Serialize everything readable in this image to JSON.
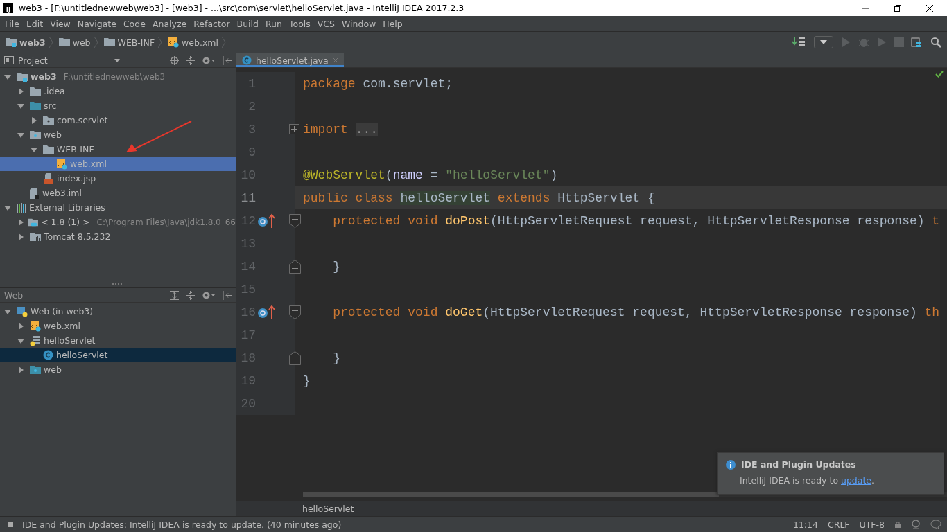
{
  "title_bar": {
    "logo": "IJ",
    "title": "web3 - [F:\\untitlednewweb\\web3] - [web3] - ...\\src\\com\\servlet\\helloServlet.java - IntelliJ IDEA 2017.2.3"
  },
  "menu": [
    {
      "label": "File"
    },
    {
      "label": "Edit"
    },
    {
      "label": "View"
    },
    {
      "label": "Navigate"
    },
    {
      "label": "Code"
    },
    {
      "label": "Analyze"
    },
    {
      "label": "Refactor"
    },
    {
      "label": "Build"
    },
    {
      "label": "Run"
    },
    {
      "label": "Tools"
    },
    {
      "label": "VCS"
    },
    {
      "label": "Window"
    },
    {
      "label": "Help"
    }
  ],
  "breadcrumbs": [
    {
      "label": "web3",
      "kind": "project"
    },
    {
      "label": "web",
      "kind": "folder"
    },
    {
      "label": "WEB-INF",
      "kind": "folder"
    },
    {
      "label": "web.xml",
      "kind": "xml"
    }
  ],
  "project_panel": {
    "title": "Project",
    "active": true,
    "tree": [
      {
        "label": "web3",
        "hint": "F:\\untitlednewweb\\web3",
        "kind": "project",
        "expanded": true,
        "selected": false,
        "children": [
          {
            "label": ".idea",
            "kind": "folder",
            "expanded": false,
            "selected": false
          },
          {
            "label": "src",
            "kind": "source",
            "expanded": true,
            "selected": false,
            "children": [
              {
                "label": "com.servlet",
                "kind": "package",
                "expanded": false,
                "selected": false
              }
            ]
          },
          {
            "label": "web",
            "kind": "webfolder",
            "expanded": true,
            "selected": false,
            "children": [
              {
                "label": "WEB-INF",
                "kind": "folder",
                "expanded": true,
                "selected": false,
                "children": [
                  {
                    "label": "web.xml",
                    "kind": "xml",
                    "selected": true
                  }
                ]
              },
              {
                "label": "index.jsp",
                "kind": "jsp",
                "selected": false
              }
            ]
          },
          {
            "label": "web3.iml",
            "kind": "iml",
            "selected": false
          }
        ]
      },
      {
        "label": "External Libraries",
        "kind": "libraries",
        "expanded": true,
        "selected": false,
        "children": [
          {
            "label": "< 1.8 (1) >",
            "hint": "C:\\Program Files\\Java\\jdk1.8.0_66",
            "kind": "jdk",
            "expanded": false,
            "selected": false
          },
          {
            "label": "Tomcat 8.5.232",
            "kind": "tomcat",
            "expanded": false,
            "selected": false
          }
        ]
      }
    ]
  },
  "web_panel": {
    "title": "Web",
    "active": false,
    "tree": [
      {
        "label": "Web (in web3)",
        "kind": "facet",
        "expanded": true,
        "selected": false,
        "children": [
          {
            "label": "web.xml",
            "kind": "xml",
            "expanded": false,
            "selected": false
          },
          {
            "label": "helloServlet",
            "kind": "servlet",
            "expanded": true,
            "selected": false,
            "children": [
              {
                "label": "helloServlet",
                "kind": "class",
                "selected": true
              }
            ]
          },
          {
            "label": "web",
            "kind": "webfolder",
            "expanded": false,
            "selected": false
          }
        ]
      }
    ]
  },
  "editor": {
    "tabs": [
      {
        "label": "helloServlet.java",
        "selected": true
      }
    ],
    "lines": [
      {
        "number": "1",
        "current": false,
        "kind": "plain",
        "tokens": [
          {
            "text": "package",
            "kind": "keyword"
          },
          {
            "text": " com.servlet;",
            "kind": "plain"
          }
        ]
      },
      {
        "number": "2",
        "current": false,
        "kind": "plain"
      },
      {
        "number": "3",
        "current": false,
        "kind": "collapsed",
        "tokens": [
          {
            "text": "import ",
            "kind": "keyword"
          },
          {
            "text": "...",
            "kind": "folded"
          }
        ]
      },
      {
        "number": "9",
        "current": false,
        "kind": "plain"
      },
      {
        "number": "10",
        "current": false,
        "kind": "plain",
        "tokens": [
          {
            "text": "@WebServlet",
            "kind": "annotation"
          },
          {
            "text": "(",
            "kind": "plain"
          },
          {
            "text": "name",
            "kind": "param"
          },
          {
            "text": " = ",
            "kind": "plain"
          },
          {
            "text": "\"helloServlet\"",
            "kind": "string"
          },
          {
            "text": ")",
            "kind": "plain"
          }
        ]
      },
      {
        "number": "11",
        "current": true,
        "kind": "plain",
        "tokens": [
          {
            "text": "public class ",
            "kind": "keyword"
          },
          {
            "text": "helloServlet",
            "kind": "usage"
          },
          {
            "text": " extends ",
            "kind": "keyword"
          },
          {
            "text": "HttpServlet {",
            "kind": "plain"
          }
        ]
      },
      {
        "number": "12",
        "current": false,
        "kind": "override",
        "tokens": [
          {
            "text": "    protected void ",
            "kind": "keyword"
          },
          {
            "text": "doPost",
            "kind": "method"
          },
          {
            "text": "(HttpServletRequest request, HttpServletResponse response) ",
            "kind": "plain"
          },
          {
            "text": "t",
            "kind": "keyword"
          }
        ]
      },
      {
        "number": "13",
        "current": false,
        "kind": "plain"
      },
      {
        "number": "14",
        "current": false,
        "kind": "block-end",
        "tokens": [
          {
            "text": "    }",
            "kind": "plain"
          }
        ]
      },
      {
        "number": "15",
        "current": false,
        "kind": "plain"
      },
      {
        "number": "16",
        "current": false,
        "kind": "override",
        "tokens": [
          {
            "text": "    protected void ",
            "kind": "keyword"
          },
          {
            "text": "doGet",
            "kind": "method"
          },
          {
            "text": "(HttpServletRequest request, HttpServletResponse response) ",
            "kind": "plain"
          },
          {
            "text": "th",
            "kind": "keyword"
          }
        ]
      },
      {
        "number": "17",
        "current": false,
        "kind": "plain"
      },
      {
        "number": "18",
        "current": false,
        "kind": "block-end",
        "tokens": [
          {
            "text": "    }",
            "kind": "plain"
          }
        ]
      },
      {
        "number": "19",
        "current": false,
        "kind": "plain",
        "tokens": [
          {
            "text": "}",
            "kind": "plain"
          }
        ]
      },
      {
        "number": "20",
        "current": false,
        "kind": "plain"
      }
    ],
    "breadcrumb": "helloServlet"
  },
  "notification": {
    "title": "IDE and Plugin Updates",
    "text": "IntelliJ IDEA is ready to ",
    "link": "update",
    "tail": "."
  },
  "status_bar": {
    "message": "IDE and Plugin Updates: IntelliJ IDEA is ready to update. (40 minutes ago)",
    "position": "11:14",
    "line_separator": "CRLF",
    "encoding": "UTF-8"
  }
}
